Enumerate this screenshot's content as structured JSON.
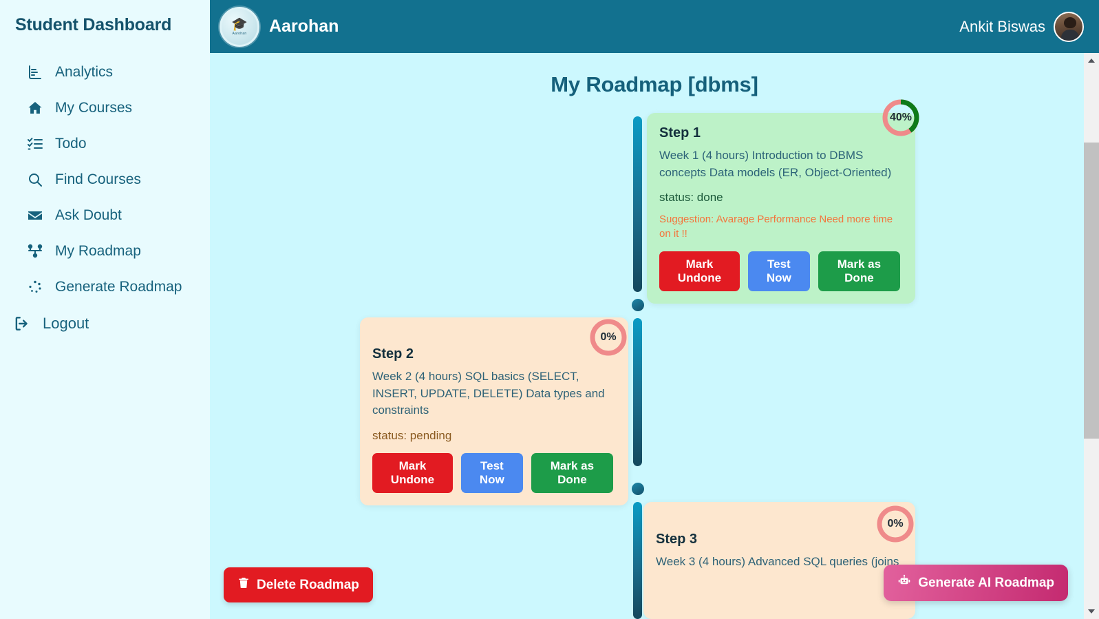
{
  "sidebar": {
    "title": "Student Dashboard",
    "items": [
      {
        "label": "Analytics",
        "icon": "analytics-chart-icon"
      },
      {
        "label": "My Courses",
        "icon": "home-icon"
      },
      {
        "label": "Todo",
        "icon": "checklist-icon"
      },
      {
        "label": "Find Courses",
        "icon": "search-icon"
      },
      {
        "label": "Ask Doubt",
        "icon": "envelope-icon"
      },
      {
        "label": "My Roadmap",
        "icon": "sitemap-icon"
      },
      {
        "label": "Generate Roadmap",
        "icon": "spinner-dots-icon"
      }
    ],
    "logout": {
      "label": "Logout",
      "icon": "logout-arrow-icon"
    }
  },
  "topbar": {
    "brand_name": "Aarohan",
    "logo_word": "Aarohan",
    "user_name": "Ankit Biswas",
    "bg_color": "#12718f"
  },
  "page": {
    "title": "My Roadmap [dbms]",
    "background_color": "#ccf8fe"
  },
  "steps": [
    {
      "title": "Step 1",
      "description": "Week 1 (4 hours) Introduction to DBMS concepts Data models (ER, Object-Oriented)",
      "status": "status: done",
      "suggestion": "Suggestion: Avarage Performance Need more time on it !!",
      "progress": 40,
      "progress_label": "40%",
      "state": "done",
      "card_color": "#bdf2c8",
      "buttons": [
        {
          "label": "Mark Undone",
          "color": "#e21b22"
        },
        {
          "label": "Test Now",
          "color": "#4b89f0"
        },
        {
          "label": "Mark as Done",
          "color": "#1d9c49"
        }
      ]
    },
    {
      "title": "Step 2",
      "description": "Week 2 (4 hours) SQL basics (SELECT, INSERT, UPDATE, DELETE) Data types and constraints",
      "status": "status: pending",
      "suggestion": "",
      "progress": 0,
      "progress_label": "0%",
      "state": "pending",
      "card_color": "#fde7cf",
      "buttons": [
        {
          "label": "Mark Undone",
          "color": "#e21b22"
        },
        {
          "label": "Test Now",
          "color": "#4b89f0"
        },
        {
          "label": "Mark as Done",
          "color": "#1d9c49"
        }
      ]
    },
    {
      "title": "Step 3",
      "description": "Week 3 (4 hours) Advanced SQL queries (joins",
      "status": "",
      "suggestion": "",
      "progress": 0,
      "progress_label": "0%",
      "state": "pending",
      "card_color": "#fde7cf",
      "buttons": []
    }
  ],
  "actions": {
    "delete_roadmap": {
      "label": "Delete Roadmap",
      "icon": "trash-icon",
      "color": "#e21b22"
    },
    "generate_ai_roadmap": {
      "label": "Generate AI Roadmap",
      "icon": "robot-icon",
      "color": "#c42a70"
    }
  },
  "scrollbar": {
    "up_icon": "caret-up-icon",
    "down_icon": "caret-down-icon"
  }
}
